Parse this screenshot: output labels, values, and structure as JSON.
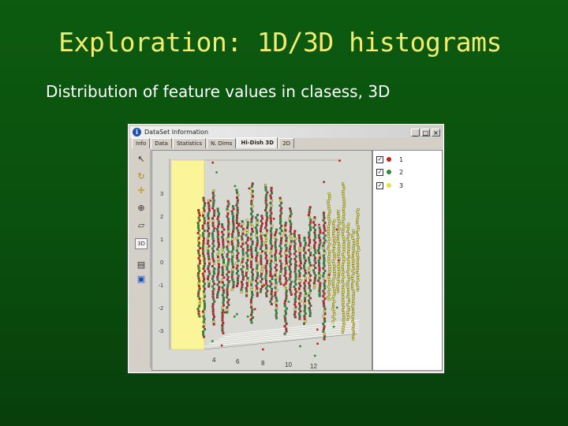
{
  "slide": {
    "title": "Exploration: 1D/3D histograms",
    "subtitle": "Distribution of feature values in clasess, 3D"
  },
  "window": {
    "title": "DataSet Information",
    "icon": "info-icon",
    "controls": [
      "_",
      "□",
      "×"
    ],
    "tabs": [
      "Info",
      "Data",
      "Statistics",
      "N. Dims",
      "Hi-Dish 3D",
      "2D"
    ],
    "active_tab": 4,
    "tools": [
      "arrow-icon",
      "rotate-icon",
      "move-icon",
      "zoom-icon",
      "select-icon",
      "3D",
      "print-icon",
      "save-icon"
    ]
  },
  "plot": {
    "y_ticks": [
      "3",
      "2",
      "1",
      "0",
      "-1",
      "-2",
      "-3"
    ],
    "x_ticks": [
      "4",
      "6",
      "8",
      "10",
      "12"
    ]
  },
  "legend": {
    "items": [
      {
        "label": "1",
        "color": "#c81e1e",
        "checked": true
      },
      {
        "label": "2",
        "color": "#2e8b2e",
        "checked": true
      },
      {
        "label": "3",
        "color": "#e8e23a",
        "checked": true
      }
    ]
  },
  "colors": {
    "slide_bg": "#0a4f0e",
    "title": "#f2ec6f",
    "highlight": "#fbf59a",
    "class1": "#c81e1e",
    "class2": "#2e8b2e",
    "class3": "#e8e23a"
  }
}
